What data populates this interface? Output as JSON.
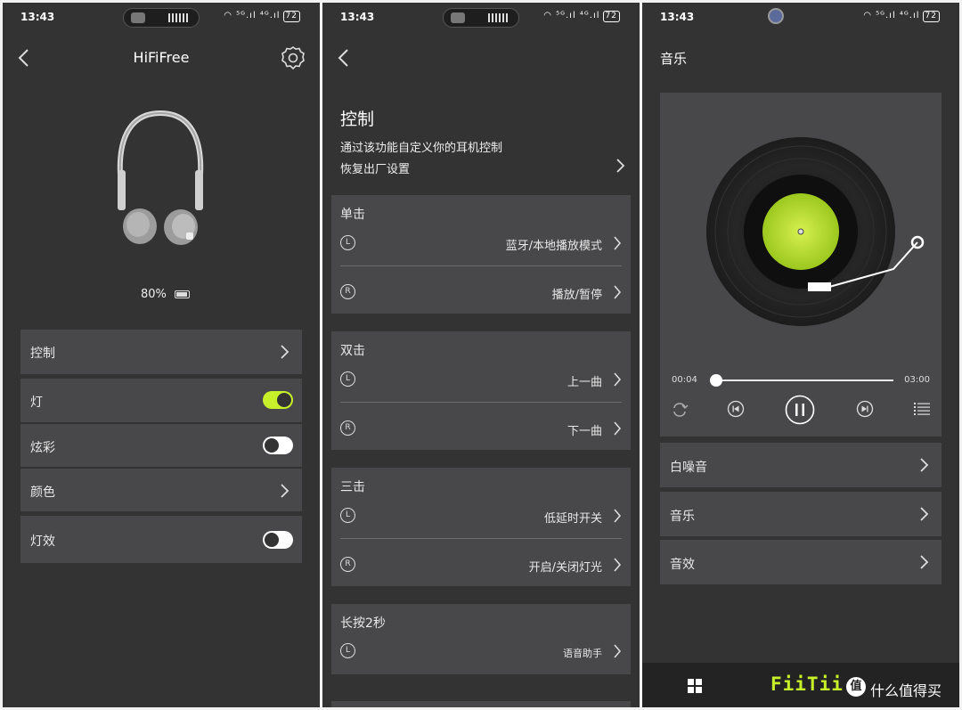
{
  "status": {
    "time": "13:43",
    "battery": "72",
    "network": "⁵ᴳ.ıl ⁴ᴳ.ıl"
  },
  "screen1": {
    "title": "HiFiFree",
    "battery_percent": "80%",
    "items": {
      "control": "控制",
      "light": "灯",
      "colorful": "炫彩",
      "color": "颜色",
      "light_effect": "灯效"
    },
    "toggles": {
      "light": true,
      "colorful": false,
      "light_effect": false
    },
    "accent_color": "#c8f02a"
  },
  "screen2": {
    "title": "控制",
    "subtitle": "通过该功能自定义你的耳机控制",
    "reset": "恢复出厂设置",
    "left_badge": "L",
    "right_badge": "R",
    "single": {
      "label": "单击",
      "left": "蓝牙/本地播放模式",
      "right": "播放/暂停"
    },
    "double": {
      "label": "双击",
      "left": "上一曲",
      "right": "下一曲"
    },
    "triple": {
      "label": "三击",
      "left": "低延时开关",
      "right": "开启/关闭灯光"
    },
    "long_press": {
      "label": "长按2秒",
      "left": "语音助手"
    }
  },
  "screen3": {
    "title": "音乐",
    "elapsed": "00:04",
    "duration": "03:00",
    "progress": 0.022,
    "items": {
      "white_noise": "白噪音",
      "music": "音乐",
      "sound_effect": "音效"
    },
    "brand": "FiiTii",
    "watermark": "什么值得买"
  }
}
